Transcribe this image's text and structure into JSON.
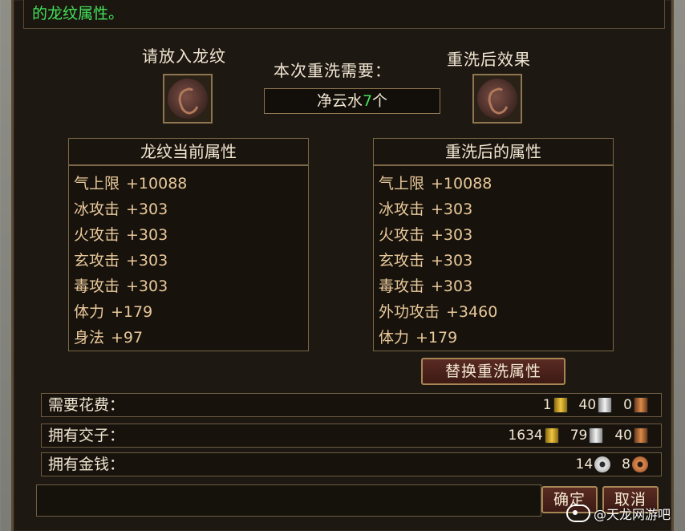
{
  "top_message": "的龙纹属性。",
  "left_slot_label": "请放入龙纹",
  "cost_label": "本次重洗需要：",
  "cost_item": "净云水",
  "cost_count": "7",
  "cost_unit": "个",
  "right_slot_label": "重洗后效果",
  "current_panel": {
    "title": "龙纹当前属性",
    "attributes": [
      {
        "name": "气上限",
        "value": "+10088"
      },
      {
        "name": "冰攻击",
        "value": "+303"
      },
      {
        "name": "火攻击",
        "value": "+303"
      },
      {
        "name": "玄攻击",
        "value": "+303"
      },
      {
        "name": "毒攻击",
        "value": "+303"
      },
      {
        "name": "体力",
        "value": "+179"
      },
      {
        "name": "身法",
        "value": "+97"
      }
    ]
  },
  "after_panel": {
    "title": "重洗后的属性",
    "attributes": [
      {
        "name": "气上限",
        "value": "+10088"
      },
      {
        "name": "冰攻击",
        "value": "+303"
      },
      {
        "name": "火攻击",
        "value": "+303"
      },
      {
        "name": "玄攻击",
        "value": "+303"
      },
      {
        "name": "毒攻击",
        "value": "+303"
      },
      {
        "name": "外功攻击",
        "value": "+3460"
      },
      {
        "name": "体力",
        "value": "+179"
      }
    ]
  },
  "replace_button": "替换重洗属性",
  "cost_bar": {
    "label": "需要花费：",
    "gold": "1",
    "silver": "40",
    "copper": "0"
  },
  "jiaozi_bar": {
    "label": "拥有交子：",
    "gold": "1634",
    "silver": "79",
    "copper": "40"
  },
  "money_bar": {
    "label": "拥有金钱：",
    "silver": "14",
    "copper": "8"
  },
  "confirm_button": "确定",
  "cancel_button": "取消",
  "watermark": "@天龙网游吧",
  "icons": [
    "dragon-pattern-icon",
    "gold-ingot-icon",
    "silver-ingot-icon",
    "copper-ingot-icon",
    "silver-coin-icon",
    "copper-coin-icon"
  ]
}
